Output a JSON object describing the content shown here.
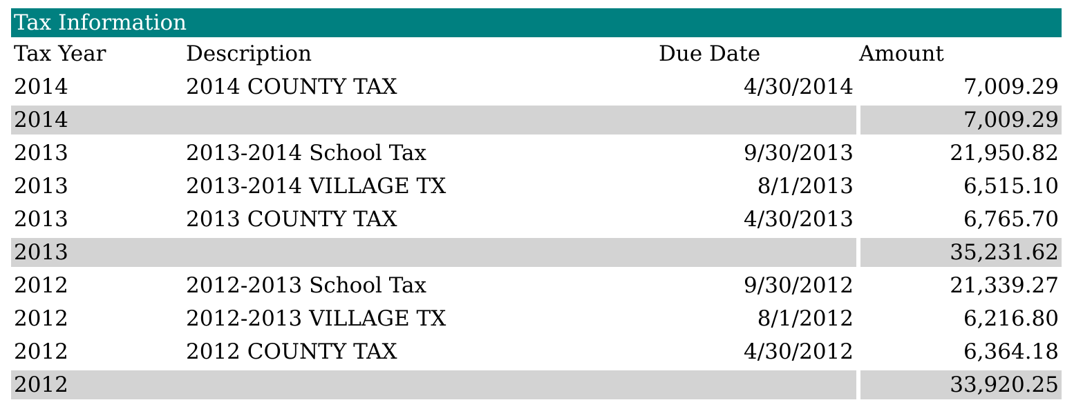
{
  "title": "Tax Information",
  "columns": {
    "tax_year": "Tax Year",
    "description": "Description",
    "due_date": "Due Date",
    "amount": "Amount"
  },
  "rows": [
    {
      "type": "detail",
      "tax_year": "2014",
      "description": "2014 COUNTY TAX",
      "due_date": "4/30/2014",
      "amount": "7,009.29"
    },
    {
      "type": "subtotal",
      "tax_year": "2014",
      "description": "",
      "due_date": "",
      "amount": "7,009.29"
    },
    {
      "type": "detail",
      "tax_year": "2013",
      "description": "2013-2014 School Tax",
      "due_date": "9/30/2013",
      "amount": "21,950.82"
    },
    {
      "type": "detail",
      "tax_year": "2013",
      "description": "2013-2014 VILLAGE TX",
      "due_date": "8/1/2013",
      "amount": "6,515.10"
    },
    {
      "type": "detail",
      "tax_year": "2013",
      "description": "2013 COUNTY TAX",
      "due_date": "4/30/2013",
      "amount": "6,765.70"
    },
    {
      "type": "subtotal",
      "tax_year": "2013",
      "description": "",
      "due_date": "",
      "amount": "35,231.62"
    },
    {
      "type": "detail",
      "tax_year": "2012",
      "description": "2012-2013 School Tax",
      "due_date": "9/30/2012",
      "amount": "21,339.27"
    },
    {
      "type": "detail",
      "tax_year": "2012",
      "description": "2012-2013 VILLAGE TX",
      "due_date": "8/1/2012",
      "amount": "6,216.80"
    },
    {
      "type": "detail",
      "tax_year": "2012",
      "description": "2012 COUNTY TAX",
      "due_date": "4/30/2012",
      "amount": "6,364.18"
    },
    {
      "type": "subtotal",
      "tax_year": "2012",
      "description": "",
      "due_date": "",
      "amount": "33,920.25"
    }
  ],
  "colors": {
    "title_bar": "#008080",
    "title_text": "#ffffff",
    "subtotal_band": "#d3d3d3"
  }
}
